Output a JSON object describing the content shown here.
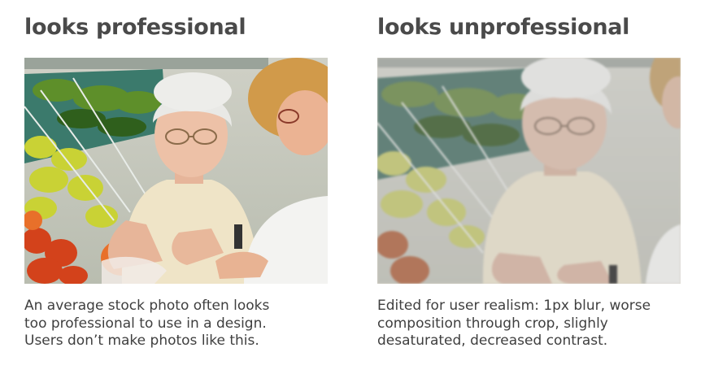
{
  "left": {
    "heading": "looks professional",
    "caption_lines": [
      "An average stock photo often looks",
      "too professional to use in a design.",
      "Users don’t make photos like this."
    ]
  },
  "right": {
    "heading": "looks unprofessional",
    "caption_lines": [
      "Edited for user realism: 1px blur, worse",
      "composition through crop, slighly",
      "desaturated, decreased contrast."
    ]
  }
}
